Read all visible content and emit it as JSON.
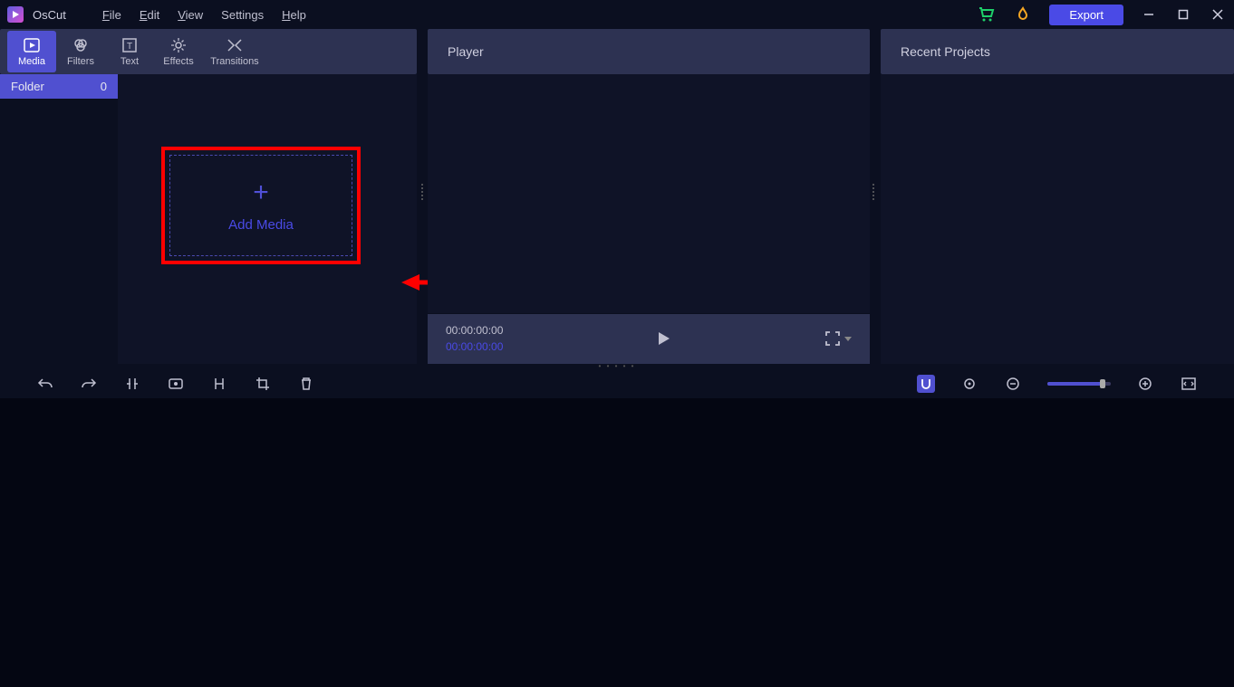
{
  "app": {
    "name": "OsCut"
  },
  "menu": {
    "file": "File",
    "edit": "Edit",
    "view": "View",
    "settings": "Settings",
    "help": "Help"
  },
  "titlebar": {
    "export": "Export"
  },
  "tools": {
    "media": "Media",
    "filters": "Filters",
    "text": "Text",
    "effects": "Effects",
    "transitions": "Transitions"
  },
  "panels": {
    "player": "Player",
    "recent": "Recent Projects"
  },
  "folder": {
    "label": "Folder",
    "count": "0"
  },
  "add_media": {
    "label": "Add Media"
  },
  "player": {
    "time_current": "00:00:00:00",
    "time_total": "00:00:00:00"
  }
}
